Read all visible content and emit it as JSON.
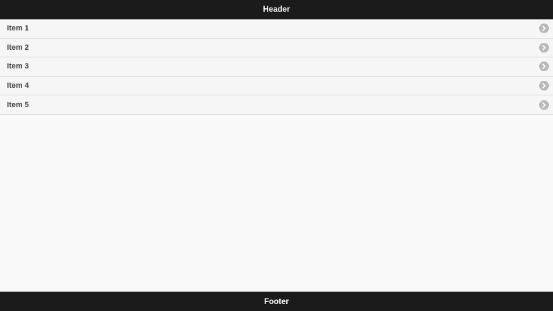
{
  "header": {
    "title": "Header"
  },
  "list": {
    "items": [
      {
        "label": "Item 1",
        "icon": "chevron-right-icon"
      },
      {
        "label": "Item 2",
        "icon": "chevron-right-icon"
      },
      {
        "label": "Item 3",
        "icon": "chevron-right-icon"
      },
      {
        "label": "Item 4",
        "icon": "chevron-right-icon"
      },
      {
        "label": "Item 5",
        "icon": "chevron-right-icon"
      }
    ]
  },
  "footer": {
    "title": "Footer"
  },
  "colors": {
    "bar_background": "#1b1b1b",
    "list_background": "#f6f6f6",
    "icon_background": "#b8b8b8",
    "text": "#333333"
  }
}
